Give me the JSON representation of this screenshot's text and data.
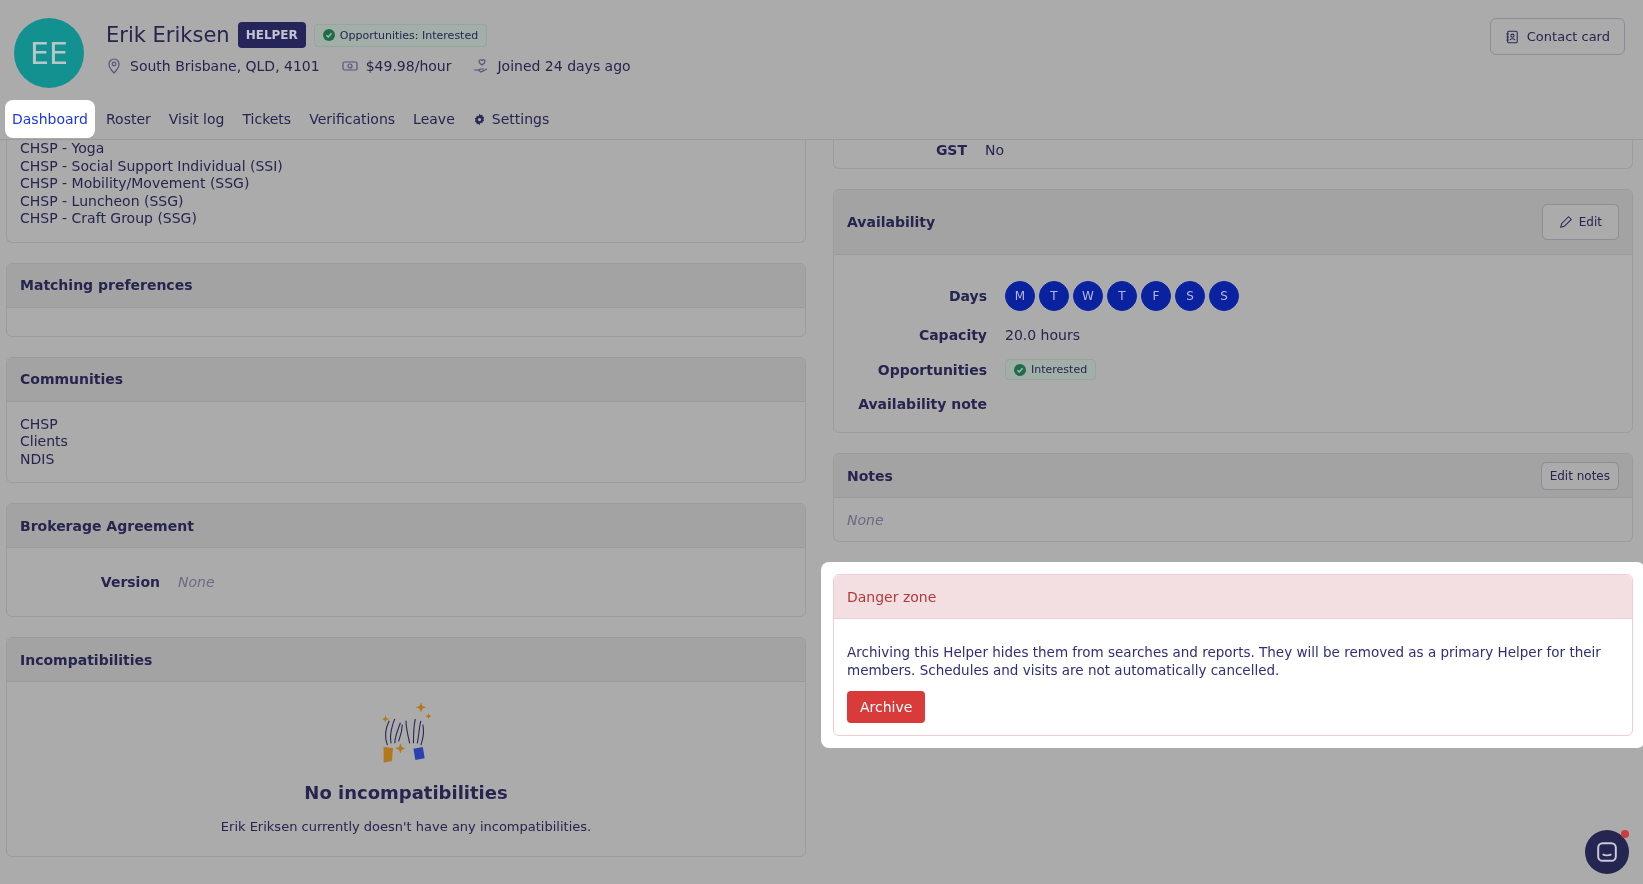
{
  "profile": {
    "initials": "EE",
    "name": "Erik Eriksen",
    "role_badge": "HELPER",
    "status_badge": "Opportunities: Interested",
    "location": "South Brisbane, QLD, 4101",
    "rate": "$49.98/hour",
    "joined": "Joined 24 days ago"
  },
  "contact_button": "Contact card",
  "tabs": [
    {
      "label": "Dashboard",
      "selected": true,
      "kind": "text"
    },
    {
      "label": "Roster",
      "selected": false,
      "kind": "text"
    },
    {
      "label": "Visit log",
      "selected": false,
      "kind": "text"
    },
    {
      "label": "Tickets",
      "selected": false,
      "kind": "text"
    },
    {
      "label": "Verifications",
      "selected": false,
      "kind": "text"
    },
    {
      "label": "Leave",
      "selected": false,
      "kind": "text"
    },
    {
      "label": "Settings",
      "selected": false,
      "kind": "settings"
    }
  ],
  "left_cards": [
    {
      "kind": "list",
      "items": [
        "CHSP - Yoga",
        "CHSP - Social Support Individual (SSI)",
        "CHSP - Mobility/Movement (SSG)",
        "CHSP - Luncheon (SSG)",
        "CHSP - Craft Group (SSG)"
      ]
    },
    {
      "kind": "empty",
      "title": "Matching preferences"
    },
    {
      "kind": "list",
      "title": "Communities",
      "items": [
        "CHSP",
        "Clients",
        "NDIS"
      ]
    },
    {
      "kind": "fields",
      "title": "Brokerage Agreement",
      "fields": [
        {
          "label": "Version",
          "value": "None",
          "muted": true
        }
      ]
    },
    {
      "kind": "empty_state",
      "title": "Incompatibilities",
      "heading": "No incompatibilities",
      "message": "Erik Eriksen currently doesn't have any incompatibilities."
    }
  ],
  "gst": {
    "label": "GST",
    "value": "No"
  },
  "availability": {
    "title": "Availability",
    "button": "Edit",
    "days_label": "Days",
    "days": [
      {
        "label": "M",
        "selected": true
      },
      {
        "label": "T",
        "selected": true
      },
      {
        "label": "W",
        "selected": true
      },
      {
        "label": "T",
        "selected": true
      },
      {
        "label": "F",
        "selected": true
      },
      {
        "label": "S",
        "selected": true
      },
      {
        "label": "S",
        "selected": true
      }
    ],
    "capacity_label": "Capacity",
    "capacity": "20.0 hours",
    "opportunities_label": "Opportunities",
    "opportunities": "Interested",
    "note_label": "Availability note"
  },
  "notes": {
    "title": "Notes",
    "button": "Edit notes",
    "value": "None"
  },
  "danger_zone": {
    "spotlight": true,
    "title": "Danger zone",
    "message": "Archiving this Helper hides them from searches and reports. They will be removed as a primary Helper for their members. Schedules and visits are not automatically cancelled.",
    "button": "Archive"
  }
}
